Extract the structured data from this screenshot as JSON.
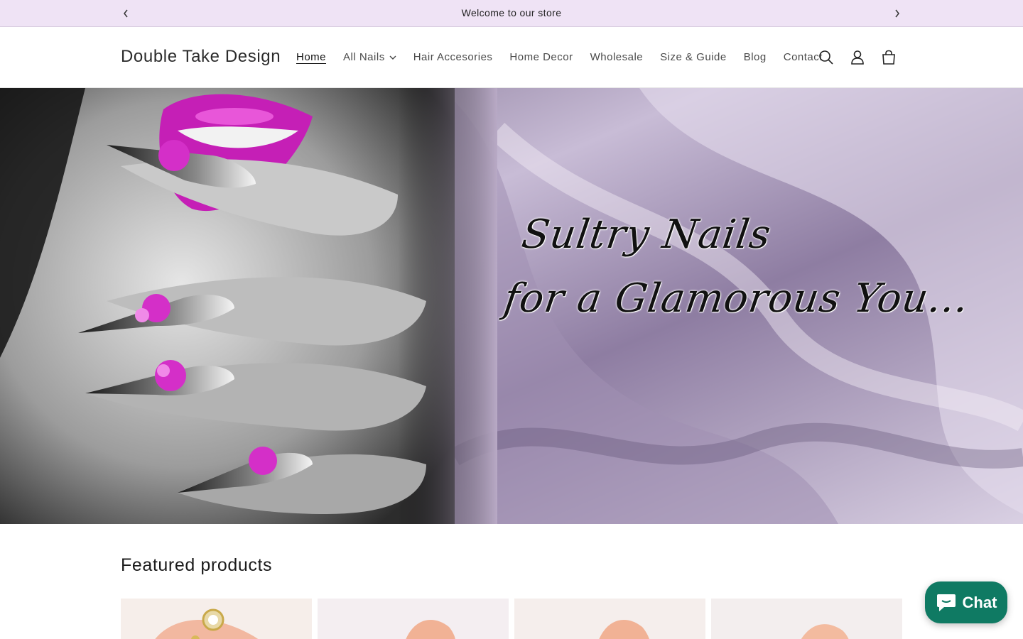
{
  "announcement": {
    "text": "Welcome to our store"
  },
  "header": {
    "logo": "Double Take Design",
    "nav": [
      {
        "label": "Home",
        "active": true
      },
      {
        "label": "All Nails",
        "has_dropdown": true
      },
      {
        "label": "Hair Accesories"
      },
      {
        "label": "Home Decor"
      },
      {
        "label": "Wholesale"
      },
      {
        "label": "Size & Guide"
      },
      {
        "label": "Blog"
      },
      {
        "label": "Contact"
      }
    ],
    "icons": [
      "search-icon",
      "account-icon",
      "cart-icon"
    ]
  },
  "hero": {
    "line1": "Sultry Nails",
    "line2": "for a Glamorous You..."
  },
  "featured": {
    "title": "Featured products",
    "product_count_visible": 4
  },
  "chat": {
    "label": "Chat"
  },
  "colors": {
    "announcement_bg": "#efe3f5",
    "chat_bg": "#0f7a63",
    "accent_magenta": "#d42fc8",
    "silk_lavender": "#b9aac6"
  }
}
